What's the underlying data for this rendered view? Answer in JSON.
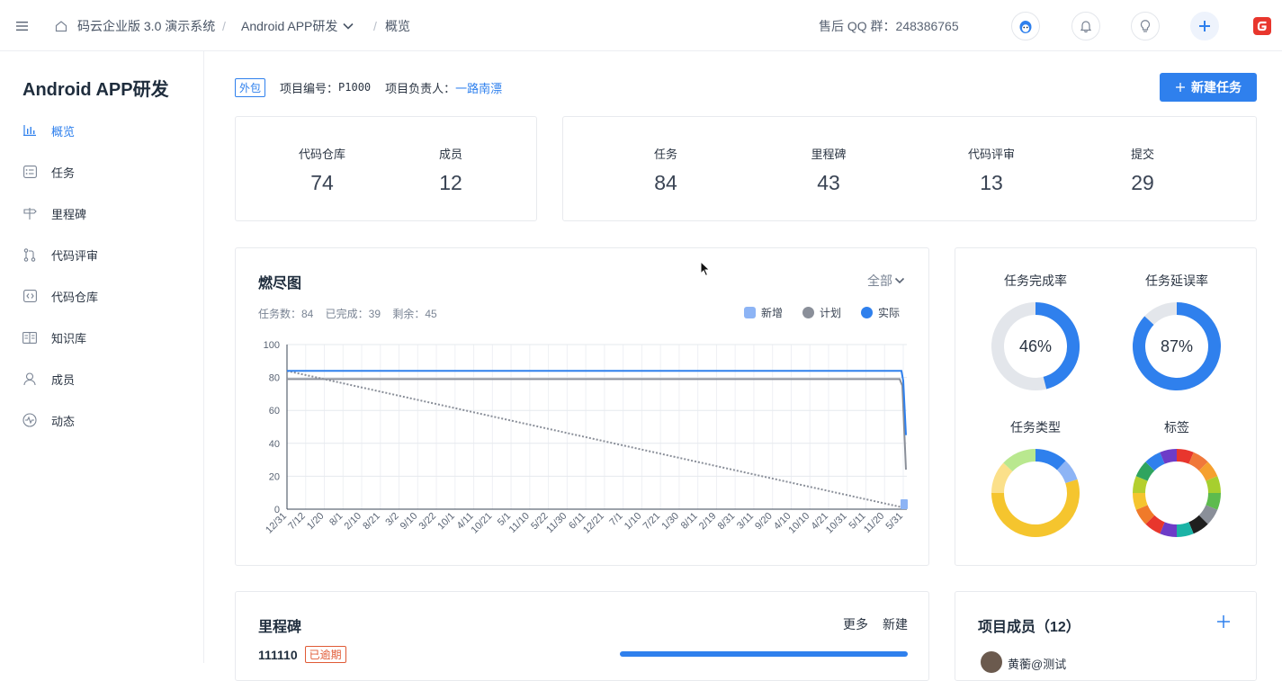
{
  "topbar": {
    "org": "码云企业版 3.0 演示系统",
    "separator": "/",
    "project": "Android APP研发",
    "page": "概览",
    "qq_group": "售后 QQ 群：248386765",
    "icons": [
      "menu-icon",
      "home-icon",
      "chevron-down-icon",
      "mascot-icon",
      "bell-icon",
      "lightbulb-icon",
      "plus-icon",
      "gitee-logo"
    ]
  },
  "sidebar": {
    "title": "Android APP研发",
    "items": [
      {
        "label": "概览",
        "icon": "bar-chart-icon",
        "active": true
      },
      {
        "label": "任务",
        "icon": "task-list-icon"
      },
      {
        "label": "里程碑",
        "icon": "signpost-icon"
      },
      {
        "label": "代码评审",
        "icon": "pull-request-icon"
      },
      {
        "label": "代码仓库",
        "icon": "code-repo-icon"
      },
      {
        "label": "知识库",
        "icon": "book-icon"
      },
      {
        "label": "成员",
        "icon": "user-icon"
      },
      {
        "label": "动态",
        "icon": "activity-icon"
      }
    ]
  },
  "header": {
    "tag": "外包",
    "project_no_label": "项目编号：",
    "project_no": "P1000",
    "owner_label": "项目负责人：",
    "owner": "一路南漂",
    "new_task": "新建任务"
  },
  "stats_left": [
    {
      "label": "代码仓库",
      "value": "74"
    },
    {
      "label": "成员",
      "value": "12"
    }
  ],
  "stats_right": [
    {
      "label": "任务",
      "value": "84"
    },
    {
      "label": "里程碑",
      "value": "43"
    },
    {
      "label": "代码评审",
      "value": "13"
    },
    {
      "label": "提交",
      "value": "29"
    }
  ],
  "burndown": {
    "title": "燃尽图",
    "filter": "全部",
    "summary": "任务数：84    已完成：39    剩余：45",
    "legend": [
      "新增",
      "计划",
      "实际"
    ],
    "colors": {
      "new": "#8db4f5",
      "plan": "#8a8f99",
      "actual": "#2f80ed"
    }
  },
  "chart_data": {
    "type": "line",
    "title": "燃尽图",
    "ylim": [
      0,
      100
    ],
    "y_ticks": [
      0,
      20,
      40,
      60,
      80,
      100
    ],
    "categories": [
      "12/31",
      "7/12",
      "1/20",
      "8/1",
      "2/10",
      "8/21",
      "3/2",
      "9/10",
      "3/22",
      "10/1",
      "4/11",
      "10/21",
      "5/1",
      "11/10",
      "5/22",
      "11/30",
      "6/11",
      "12/21",
      "7/1",
      "1/10",
      "7/21",
      "1/30",
      "8/11",
      "2/19",
      "8/31",
      "3/11",
      "9/20",
      "4/10",
      "10/10",
      "4/21",
      "10/31",
      "5/11",
      "11/20",
      "5/31"
    ],
    "series": [
      {
        "name": "实际",
        "values": "flat at 84 across all dates, dropping to about 45 at the last date"
      },
      {
        "name": "计划",
        "values": "flat at 79 across all dates, dropping to about 24 at the last date"
      },
      {
        "name": "计划",
        "style": "dotted",
        "start": 84,
        "end": 0
      }
    ],
    "grid": true,
    "legend_position": "top-right"
  },
  "rings": [
    {
      "title": "任务完成率",
      "value": "46%",
      "percent": 46
    },
    {
      "title": "任务延误率",
      "value": "87%",
      "percent": 87
    },
    {
      "title": "任务类型",
      "value": ""
    },
    {
      "title": "标签",
      "value": ""
    }
  ],
  "milestones": {
    "title": "里程碑",
    "more": "更多",
    "new": "新建",
    "items": [
      {
        "name": "111110",
        "badge": "已逾期",
        "progress": 100
      }
    ]
  },
  "members": {
    "title": "项目成员（12）",
    "first": "黄蘅@测试"
  }
}
